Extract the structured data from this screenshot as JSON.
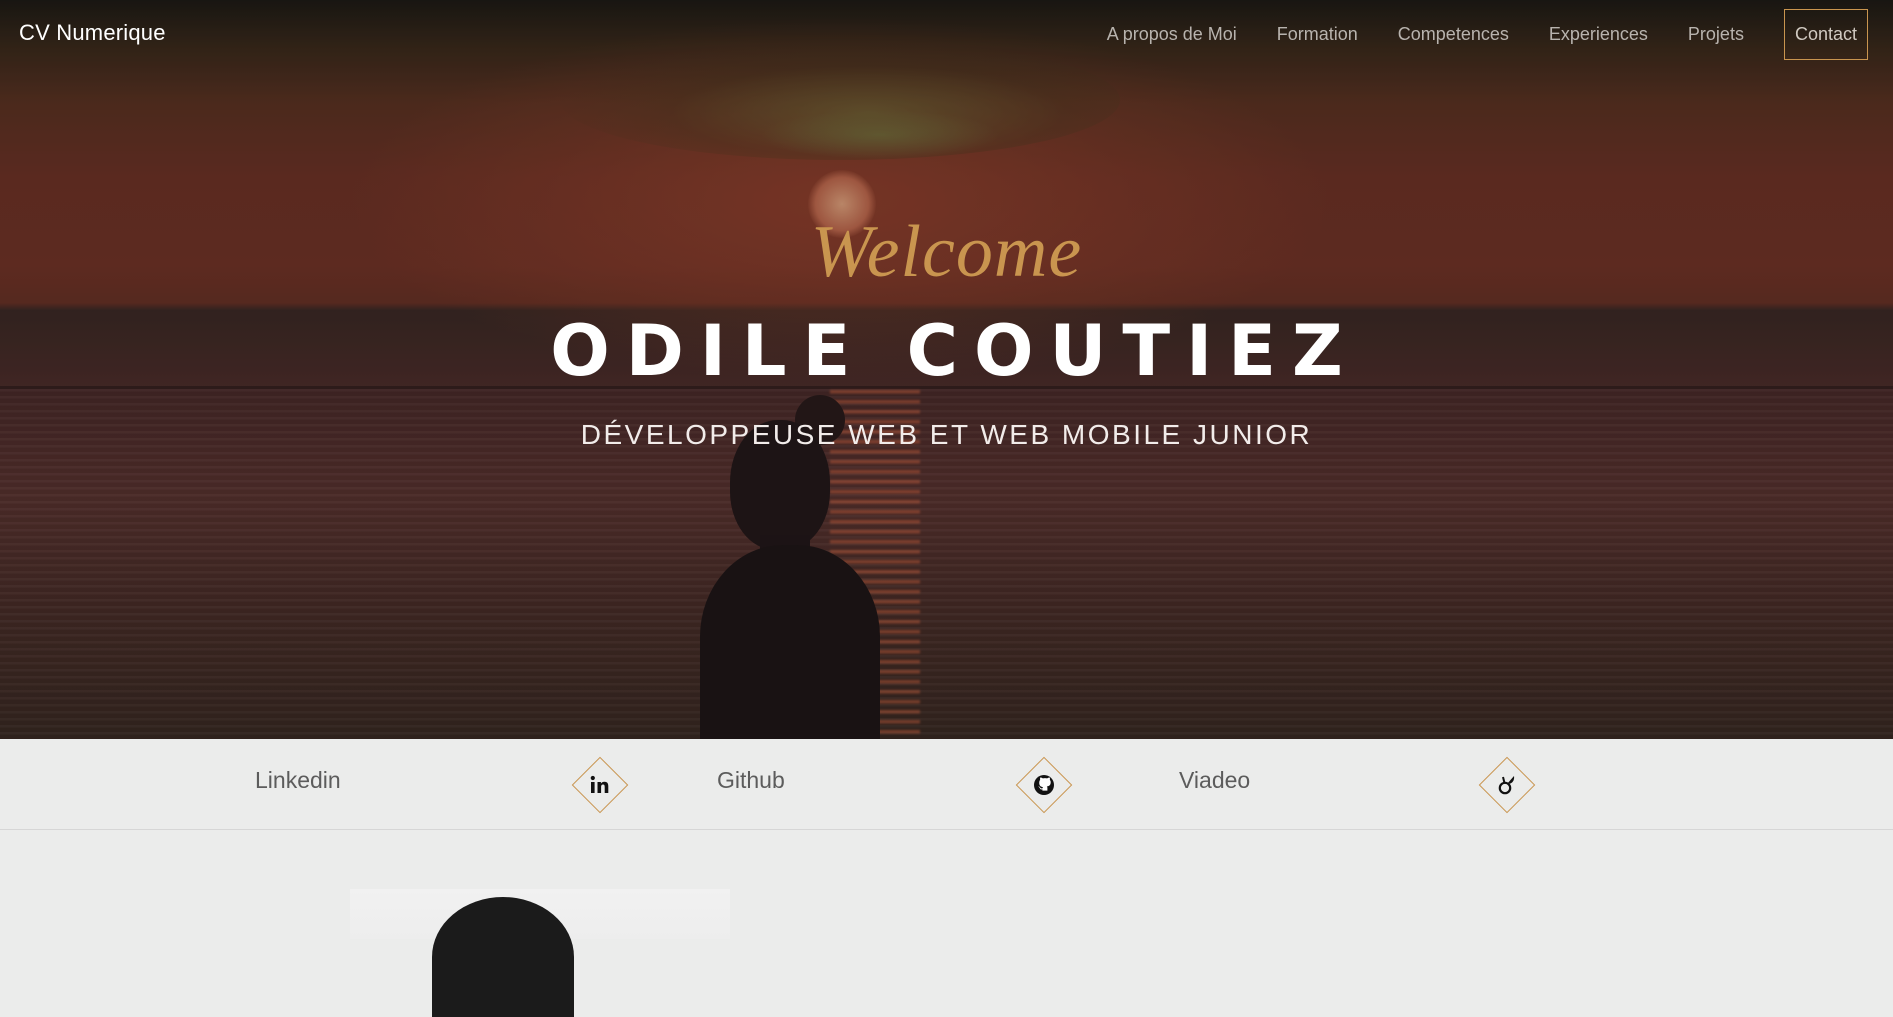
{
  "nav": {
    "brand": "CV Numerique",
    "links": [
      "A propos de Moi",
      "Formation",
      "Competences",
      "Experiences",
      "Projets"
    ],
    "contact": "Contact"
  },
  "hero": {
    "welcome": "Welcome",
    "name": "ODILE COUTIEZ",
    "subtitle": "DÉVELOPPEUSE WEB ET WEB MOBILE JUNIOR"
  },
  "social": {
    "items": [
      {
        "label": "Linkedin",
        "icon": "linkedin-icon"
      },
      {
        "label": "Github",
        "icon": "github-icon"
      },
      {
        "label": "Viadeo",
        "icon": "viadeo-icon"
      }
    ]
  },
  "colors": {
    "accent": "#c9954f",
    "nav_link": "#b8b3ae",
    "social_bar_bg": "#ebeceb"
  }
}
